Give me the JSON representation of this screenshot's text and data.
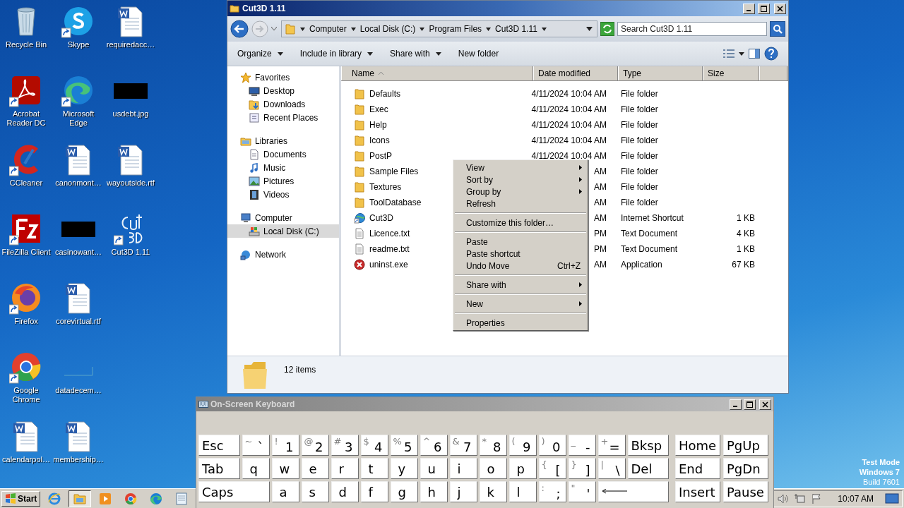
{
  "desktop_icons": [
    {
      "label": "Recycle Bin",
      "kind": "recycle",
      "shortcut": false
    },
    {
      "label": "Acrobat Reader DC",
      "kind": "acrobat",
      "shortcut": true
    },
    {
      "label": "CCleaner",
      "kind": "ccleaner",
      "shortcut": true
    },
    {
      "label": "FileZilla Client",
      "kind": "filezilla",
      "shortcut": true
    },
    {
      "label": "Firefox",
      "kind": "firefox",
      "shortcut": true
    },
    {
      "label": "Google Chrome",
      "kind": "chrome",
      "shortcut": true
    },
    {
      "label": "calendarpol…",
      "kind": "word",
      "shortcut": false
    },
    {
      "label": "Skype",
      "kind": "skype",
      "shortcut": true
    },
    {
      "label": "Microsoft Edge",
      "kind": "edge",
      "shortcut": true
    },
    {
      "label": "canonmont…",
      "kind": "word",
      "shortcut": false
    },
    {
      "label": "casinowant…",
      "kind": "redacted",
      "shortcut": false
    },
    {
      "label": "corevirtual.rtf",
      "kind": "word",
      "shortcut": false
    },
    {
      "label": "datadecem…",
      "kind": "blank",
      "shortcut": false
    },
    {
      "label": "membership…",
      "kind": "word",
      "shortcut": false
    },
    {
      "label": "requiredacc…",
      "kind": "word",
      "shortcut": false
    },
    {
      "label": "usdebt.jpg",
      "kind": "redacted",
      "shortcut": false
    },
    {
      "label": "wayoutside.rtf",
      "kind": "word",
      "shortcut": false
    },
    {
      "label": "Cut3D 1.11",
      "kind": "cut3d",
      "shortcut": true
    }
  ],
  "explorer": {
    "title": "Cut3D 1.11",
    "breadcrumbs": [
      "Computer",
      "Local Disk (C:)",
      "Program Files",
      "Cut3D 1.11"
    ],
    "search": {
      "placeholder": "Search Cut3D 1.11"
    },
    "toolbar": [
      {
        "label": "Organize",
        "dropdown": true
      },
      {
        "label": "Include in library",
        "dropdown": true
      },
      {
        "label": "Share with",
        "dropdown": true
      },
      {
        "label": "New folder",
        "dropdown": false
      }
    ],
    "navigation": [
      {
        "label": "Favorites",
        "kind": "star",
        "selected": false,
        "children": [
          {
            "label": "Desktop",
            "kind": "desktop",
            "selected": false
          },
          {
            "label": "Downloads",
            "kind": "downloads",
            "selected": false
          },
          {
            "label": "Recent Places",
            "kind": "recent",
            "selected": false
          }
        ]
      },
      {
        "label": "Libraries",
        "kind": "library",
        "selected": false,
        "children": [
          {
            "label": "Documents",
            "kind": "document",
            "selected": false
          },
          {
            "label": "Music",
            "kind": "music",
            "selected": false
          },
          {
            "label": "Pictures",
            "kind": "pictures",
            "selected": false
          },
          {
            "label": "Videos",
            "kind": "videos",
            "selected": false
          }
        ]
      },
      {
        "label": "Computer",
        "kind": "computer",
        "selected": false,
        "children": [
          {
            "label": "Local Disk (C:)",
            "kind": "disk",
            "selected": true
          }
        ]
      },
      {
        "label": "Network",
        "kind": "network",
        "selected": false
      }
    ],
    "columns": [
      {
        "label": "Name",
        "sorted": true
      },
      {
        "label": "Date modified",
        "sorted": false
      },
      {
        "label": "Type",
        "sorted": false
      },
      {
        "label": "Size",
        "sorted": false
      }
    ],
    "files": [
      {
        "name": "Defaults",
        "kind": "folder",
        "date": "4/11/2024 10:04 AM",
        "type": "File folder"
      },
      {
        "name": "Exec",
        "kind": "folder",
        "date": "4/11/2024 10:04 AM",
        "type": "File folder"
      },
      {
        "name": "Help",
        "kind": "folder",
        "date": "4/11/2024 10:04 AM",
        "type": "File folder"
      },
      {
        "name": "Icons",
        "kind": "folder",
        "date": "4/11/2024 10:04 AM",
        "type": "File folder"
      },
      {
        "name": "PostP",
        "kind": "folder",
        "date": "4/11/2024 10:04 AM",
        "type": "File folder"
      },
      {
        "name": "Sample Files",
        "kind": "folder",
        "date": "AM",
        "type": "File folder"
      },
      {
        "name": "Textures",
        "kind": "folder",
        "date": "AM",
        "type": "File folder"
      },
      {
        "name": "ToolDatabase",
        "kind": "folder",
        "date": "AM",
        "type": "File folder"
      },
      {
        "name": "Cut3D",
        "kind": "shortcut",
        "date": "AM",
        "type": "Internet Shortcut",
        "size": "1 KB"
      },
      {
        "name": "Licence.txt",
        "kind": "text",
        "date": "PM",
        "type": "Text Document",
        "size": "4 KB"
      },
      {
        "name": "readme.txt",
        "kind": "text",
        "date": "PM",
        "type": "Text Document",
        "size": "1 KB"
      },
      {
        "name": "uninst.exe",
        "kind": "exe",
        "date": "AM",
        "type": "Application",
        "size": "67 KB"
      }
    ],
    "status": "12 items",
    "context_menu": [
      {
        "kind": "item",
        "label": "View",
        "submenu": true
      },
      {
        "kind": "item",
        "label": "Sort by",
        "submenu": true
      },
      {
        "kind": "item",
        "label": "Group by",
        "submenu": true
      },
      {
        "kind": "item",
        "label": "Refresh",
        "submenu": false
      },
      {
        "kind": "separator"
      },
      {
        "kind": "item",
        "label": "Customize this folder…",
        "submenu": false
      },
      {
        "kind": "separator"
      },
      {
        "kind": "item",
        "label": "Paste",
        "submenu": false
      },
      {
        "kind": "item",
        "label": "Paste shortcut",
        "submenu": false
      },
      {
        "kind": "item",
        "label": "Undo Move",
        "submenu": false,
        "shortcut": "Ctrl+Z"
      },
      {
        "kind": "separator"
      },
      {
        "kind": "item",
        "label": "Share with",
        "submenu": true
      },
      {
        "kind": "separator"
      },
      {
        "kind": "item",
        "label": "New",
        "submenu": true
      },
      {
        "kind": "separator"
      },
      {
        "kind": "item",
        "label": "Properties",
        "submenu": false
      }
    ]
  },
  "keyboard": {
    "title": "On-Screen Keyboard",
    "rows": [
      {
        "keys": [
          {
            "kind": "function",
            "label": "Esc"
          },
          {
            "kind": "char",
            "shift": "~",
            "label": "`"
          },
          {
            "kind": "char",
            "shift": "!",
            "label": "1"
          },
          {
            "kind": "char",
            "shift": "@",
            "label": "2"
          },
          {
            "kind": "char",
            "shift": "#",
            "label": "3"
          },
          {
            "kind": "char",
            "shift": "$",
            "label": "4"
          },
          {
            "kind": "char",
            "shift": "%",
            "label": "5"
          },
          {
            "kind": "char",
            "shift": "^",
            "label": "6"
          },
          {
            "kind": "char",
            "shift": "&",
            "label": "7"
          },
          {
            "kind": "char",
            "shift": "*",
            "label": "8"
          },
          {
            "kind": "char",
            "shift": "(",
            "label": "9"
          },
          {
            "kind": "char",
            "shift": ")",
            "label": "0"
          },
          {
            "kind": "char",
            "shift": "_",
            "label": "-"
          },
          {
            "kind": "char",
            "shift": "+",
            "label": "="
          },
          {
            "kind": "function",
            "label": "Bksp"
          }
        ],
        "nav_keys": [
          "Home",
          "PgUp"
        ]
      },
      {
        "keys": [
          {
            "kind": "function",
            "label": "Tab"
          },
          {
            "kind": "char",
            "label": "q"
          },
          {
            "kind": "char",
            "label": "w"
          },
          {
            "kind": "char",
            "label": "e"
          },
          {
            "kind": "char",
            "label": "r"
          },
          {
            "kind": "char",
            "label": "t"
          },
          {
            "kind": "char",
            "label": "y"
          },
          {
            "kind": "char",
            "label": "u"
          },
          {
            "kind": "char",
            "label": "i"
          },
          {
            "kind": "char",
            "label": "o"
          },
          {
            "kind": "char",
            "label": "p"
          },
          {
            "kind": "char",
            "shift": "{",
            "label": "["
          },
          {
            "kind": "char",
            "shift": "}",
            "label": "]"
          },
          {
            "kind": "char",
            "shift": "|",
            "label": "\\"
          },
          {
            "kind": "function",
            "label": "Del"
          }
        ],
        "nav_keys": [
          "End",
          "PgDn"
        ]
      },
      {
        "keys": [
          {
            "kind": "function",
            "label": "Caps"
          },
          {
            "kind": "char",
            "label": "a"
          },
          {
            "kind": "char",
            "label": "s"
          },
          {
            "kind": "char",
            "label": "d"
          },
          {
            "kind": "char",
            "label": "f"
          },
          {
            "kind": "char",
            "label": "g"
          },
          {
            "kind": "char",
            "label": "h"
          },
          {
            "kind": "char",
            "label": "j"
          },
          {
            "kind": "char",
            "label": "k"
          },
          {
            "kind": "char",
            "label": "l"
          },
          {
            "kind": "char",
            "shift": ":",
            "label": ";"
          },
          {
            "kind": "char",
            "shift": "\"",
            "label": "'"
          },
          {
            "kind": "enter"
          }
        ],
        "nav_keys": [
          "Insert",
          "Pause"
        ]
      }
    ]
  },
  "taskbar": {
    "start": "Start",
    "apps": [
      {
        "kind": "ie",
        "active": false
      },
      {
        "kind": "explorer",
        "active": true
      },
      {
        "kind": "media",
        "active": false
      },
      {
        "kind": "chrome",
        "active": false
      },
      {
        "kind": "edge",
        "active": false
      },
      {
        "kind": "notepad",
        "active": false
      }
    ],
    "clock": "10:07 AM"
  },
  "watermark": [
    "Test Mode",
    "Windows 7",
    "Build 7601"
  ]
}
